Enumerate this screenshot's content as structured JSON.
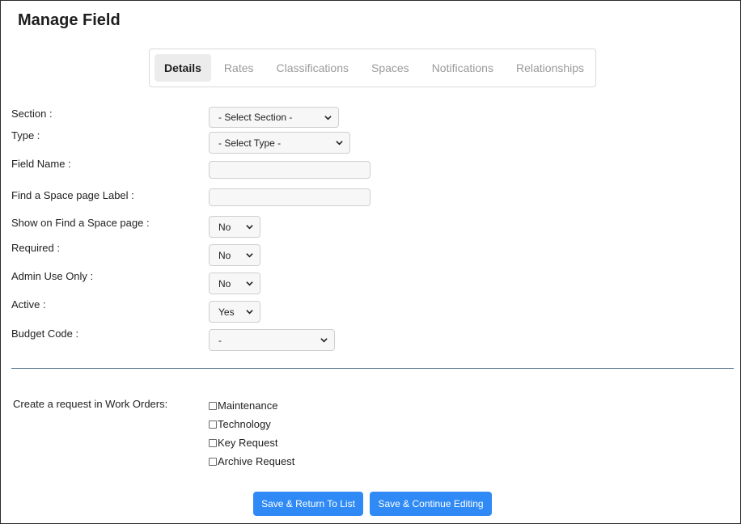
{
  "page": {
    "title": "Manage Field"
  },
  "tabs": [
    {
      "label": "Details",
      "active": true
    },
    {
      "label": "Rates",
      "active": false
    },
    {
      "label": "Classifications",
      "active": false
    },
    {
      "label": "Spaces",
      "active": false
    },
    {
      "label": "Notifications",
      "active": false
    },
    {
      "label": "Relationships",
      "active": false
    }
  ],
  "form": {
    "section": {
      "label": "Section :",
      "value": "- Select Section -"
    },
    "type": {
      "label": "Type :",
      "value": "- Select Type -"
    },
    "field_name": {
      "label": "Field Name :",
      "value": ""
    },
    "find_space_label": {
      "label": "Find a Space page Label :",
      "value": ""
    },
    "show_on_find_space": {
      "label": "Show on Find a Space page :",
      "value": "No"
    },
    "required": {
      "label": "Required :",
      "value": "No"
    },
    "admin_use_only": {
      "label": "Admin Use Only :",
      "value": "No"
    },
    "active": {
      "label": "Active :",
      "value": "Yes"
    },
    "budget_code": {
      "label": "Budget Code :",
      "value": "-"
    }
  },
  "work_orders": {
    "label": "Create a request in Work Orders:",
    "options": [
      {
        "label": "Maintenance",
        "checked": false
      },
      {
        "label": "Technology",
        "checked": false
      },
      {
        "label": "Key Request",
        "checked": false
      },
      {
        "label": "Archive Request",
        "checked": false
      }
    ]
  },
  "buttons": {
    "save_return": "Save & Return To List",
    "save_continue": "Save & Continue Editing"
  },
  "colors": {
    "primary_button": "#2f8af5",
    "divider": "#4f6f86",
    "tab_active_bg": "#ececec",
    "tab_inactive_text": "#9a9a9a"
  },
  "icons": {
    "select_arrow": "chevron-down-icon"
  }
}
